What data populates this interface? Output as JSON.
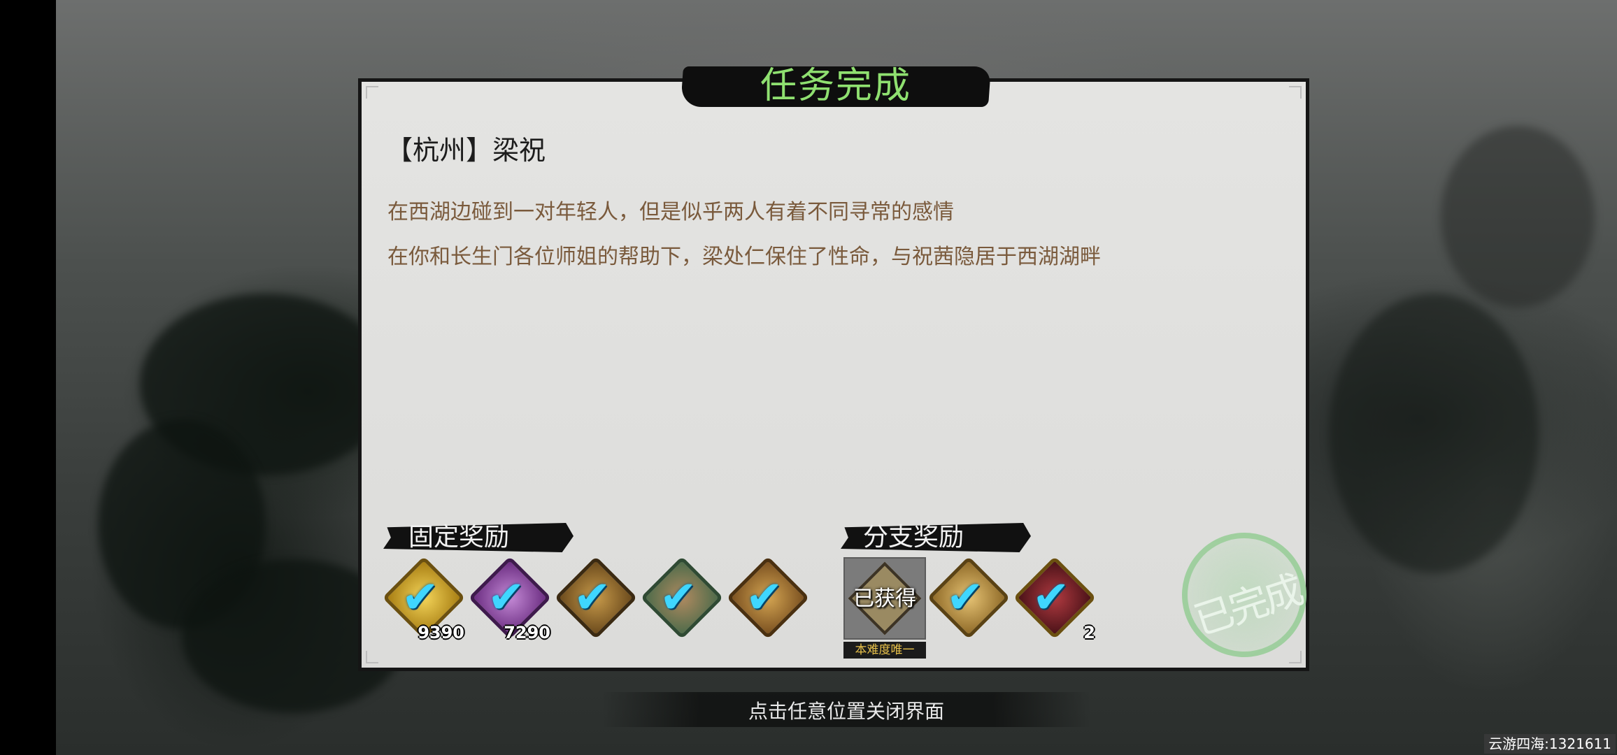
{
  "dialog": {
    "title": "任务完成",
    "quest_name": "【杭州】梁祝",
    "description": [
      "在西湖边碰到一对年轻人，但是似乎两人有着不同寻常的感情",
      "在你和长生门各位师姐的帮助下，梁处仁保住了性命，与祝茜隐居于西湖湖畔"
    ]
  },
  "fixed_rewards": {
    "label": "固定奖励",
    "items": [
      {
        "icon": "gold-coin-icon",
        "quantity": "9390",
        "claimed": true
      },
      {
        "icon": "purple-coin-icon",
        "quantity": "7290",
        "claimed": true
      },
      {
        "icon": "brown-scroll-icon",
        "quantity": "",
        "claimed": true
      },
      {
        "icon": "green-item-icon",
        "quantity": "",
        "claimed": true
      },
      {
        "icon": "orange-item-icon",
        "quantity": "",
        "claimed": true
      }
    ]
  },
  "branch_rewards": {
    "label": "分支奖励",
    "obtained_text": "已获得",
    "unique_tag": "本难度唯一",
    "items": [
      {
        "icon": "gold-scroll-icon",
        "quantity": "",
        "claimed": true
      },
      {
        "icon": "red-gem-icon",
        "quantity": "2",
        "claimed": true
      }
    ]
  },
  "completed_stamp": "已完成",
  "close_hint": "点击任意位置关闭界面",
  "watermark": "云游四海:1321611",
  "colors": {
    "title_green": "#8fe070",
    "description_brown": "#7a5a3c",
    "check_blue": "#3fd6ff"
  }
}
